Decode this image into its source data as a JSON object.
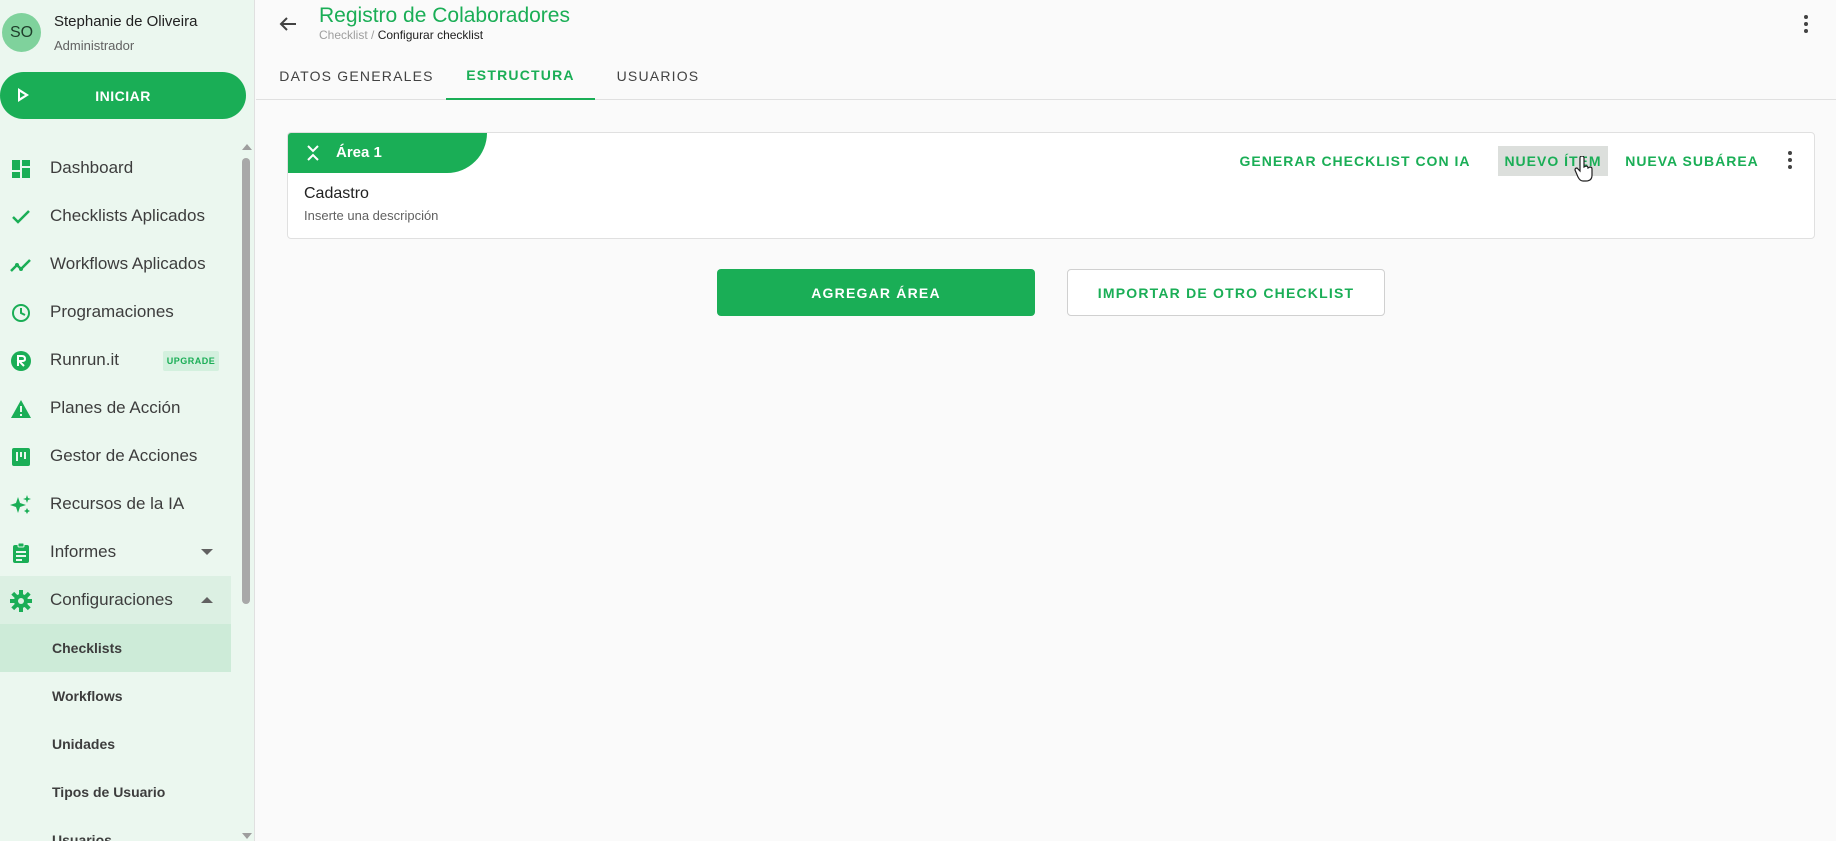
{
  "user": {
    "initials": "SO",
    "name": "Stephanie de Oliveira",
    "role": "Administrador"
  },
  "start_button": {
    "label": "INICIAR"
  },
  "sidebar": {
    "items": [
      {
        "label": "Dashboard",
        "icon": "dashboard-icon"
      },
      {
        "label": "Checklists Aplicados",
        "icon": "check-icon"
      },
      {
        "label": "Workflows Aplicados",
        "icon": "trending-icon"
      },
      {
        "label": "Programaciones",
        "icon": "clock-icon"
      },
      {
        "label": "Runrun.it",
        "icon": "runrun-logo-icon",
        "badge": "UPGRADE"
      },
      {
        "label": "Planes de Acción",
        "icon": "warning-icon"
      },
      {
        "label": "Gestor de Acciones",
        "icon": "kanban-icon"
      },
      {
        "label": "Recursos de la IA",
        "icon": "sparkle-icon"
      },
      {
        "label": "Informes",
        "icon": "clipboard-icon"
      },
      {
        "label": "Configuraciones",
        "icon": "gear-icon"
      }
    ],
    "sub_items": [
      {
        "label": "Checklists",
        "selected": true
      },
      {
        "label": "Workflows"
      },
      {
        "label": "Unidades"
      },
      {
        "label": "Tipos de Usuario"
      },
      {
        "label": "Usuarios"
      }
    ]
  },
  "header": {
    "title": "Registro de Colaboradores",
    "breadcrumb": {
      "first": "Checklist",
      "separator": " / ",
      "current": "Configurar checklist"
    }
  },
  "tabs": [
    {
      "label": "DATOS GENERALES"
    },
    {
      "label": "ESTRUCTURA",
      "active": true
    },
    {
      "label": "USUARIOS"
    }
  ],
  "area": {
    "tag": "Área 1",
    "title": "Cadastro",
    "description": "Inserte una descripción",
    "actions": {
      "generate": "GENERAR CHECKLIST CON IA",
      "new_item": "NUEVO ÍTEM",
      "new_subarea": "NUEVA SUBÁREA"
    }
  },
  "buttons": {
    "add_area": "AGREGAR ÁREA",
    "import": "IMPORTAR DE OTRO CHECKLIST"
  },
  "colors": {
    "accent": "#1aae56",
    "sidebar_bg": "#ebf7ef"
  }
}
